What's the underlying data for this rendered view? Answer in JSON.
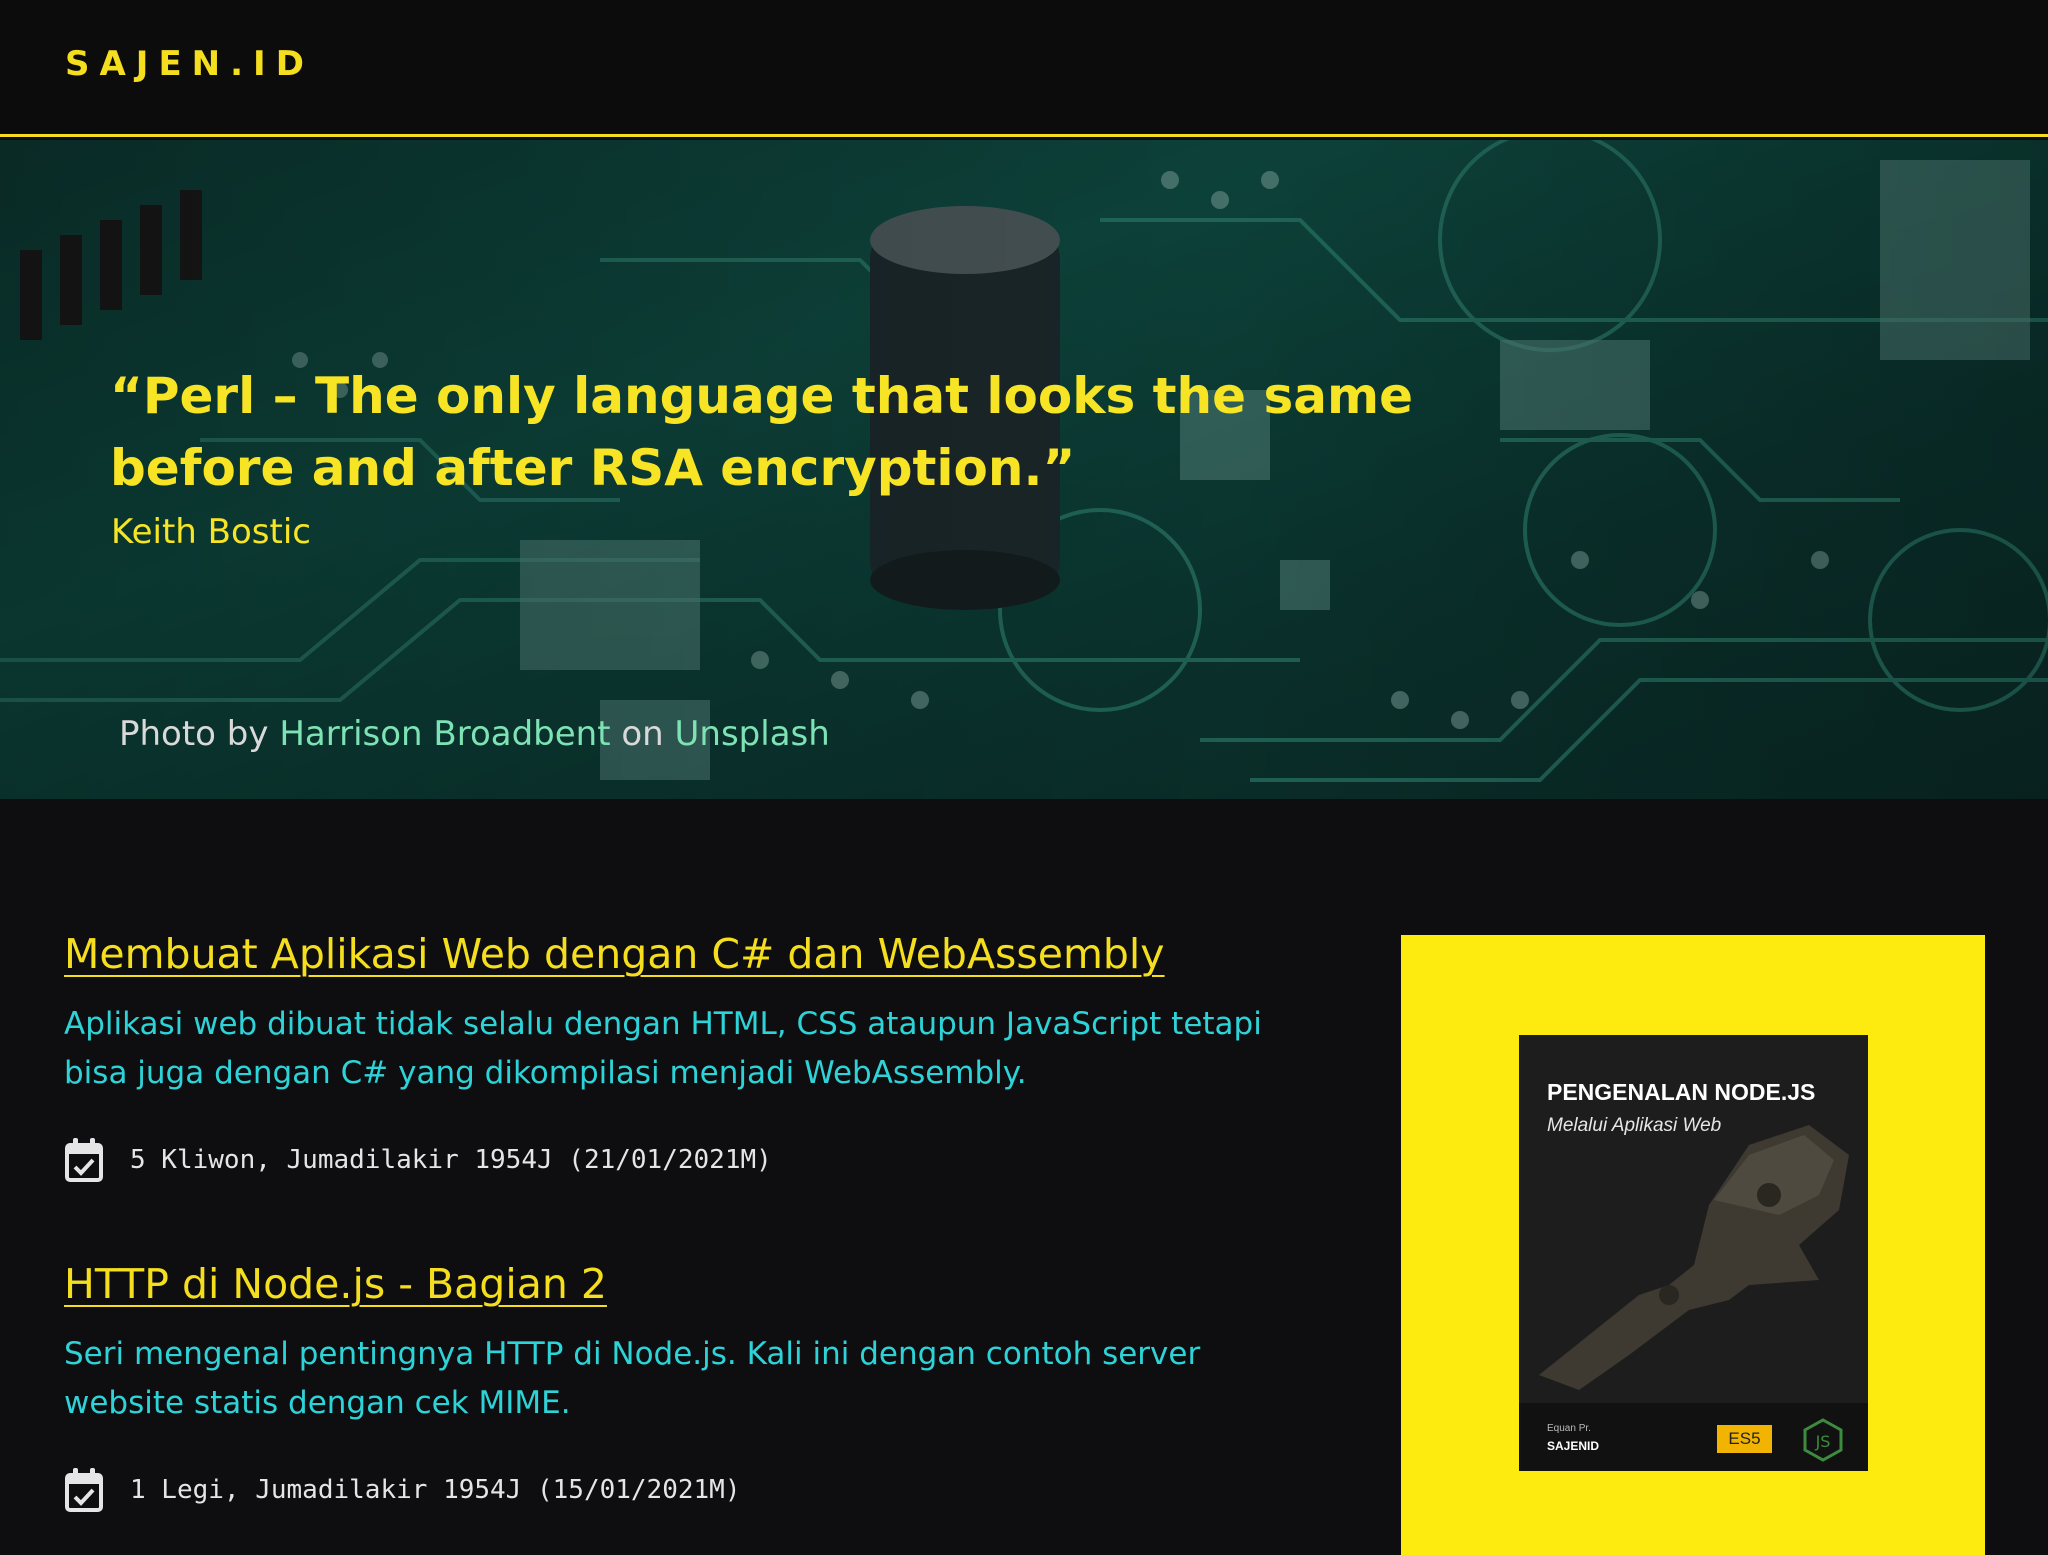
{
  "header": {
    "logo": "SAJEN.ID"
  },
  "hero": {
    "quote": "“Perl – The only language that looks the same before and after RSA encryption.”",
    "author": "Keith Bostic",
    "credit_prefix": "Photo by ",
    "credit_photographer": "Harrison Broadbent",
    "credit_middle": " on ",
    "credit_site": "Unsplash"
  },
  "posts": [
    {
      "title": "Membuat Aplikasi Web dengan C# dan WebAssembly",
      "excerpt": "Aplikasi web dibuat tidak selalu dengan HTML, CSS ataupun JavaScript tetapi bisa juga dengan C# yang dikompilasi menjadi WebAssembly.",
      "date": "5 Kliwon, Jumadilakir 1954J (21/01/2021M)"
    },
    {
      "title": "HTTP di Node.js - Bagian 2",
      "excerpt": "Seri mengenal pentingnya HTTP di Node.js. Kali ini dengan contoh server website statis dengan cek MIME.",
      "date": "1 Legi, Jumadilakir 1954J (15/01/2021M)"
    }
  ],
  "ad": {
    "book_title": "PENGENALAN NODE.JS",
    "book_subtitle": "Melalui Aplikasi Web",
    "book_author": "Equan Pr.",
    "book_publisher": "SAJENID",
    "book_badge": "ES5",
    "book_logo_icon": "nodejs-icon"
  },
  "icons": {
    "calendar": "calendar-check-icon"
  },
  "colors": {
    "accent": "#f4de1e",
    "excerpt": "#2ed3d8",
    "background": "#0e0e10",
    "ad_background": "#fdea0e"
  }
}
